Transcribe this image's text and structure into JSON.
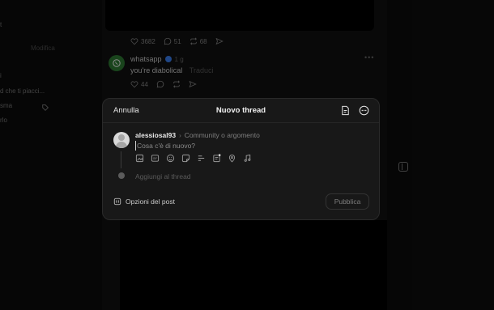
{
  "background": {
    "left_sidebar": {
      "items": [
        "t",
        "Modifica",
        "i",
        "d che ti piacci...",
        "sma",
        "rlo"
      ]
    },
    "top_post_actions": {
      "likes": "3682",
      "comments": "51",
      "reposts": "68"
    },
    "post": {
      "username": "whatsapp",
      "time": "1 g",
      "text": "you're diabolical",
      "translate": "Traduci",
      "likes": "44"
    }
  },
  "modal": {
    "cancel_label": "Annulla",
    "title": "Nuovo thread",
    "author": {
      "username": "alessiosal93",
      "topic_placeholder": "Community o argomento"
    },
    "compose": {
      "placeholder": "Cosa c'è di nuovo?"
    },
    "toolbar_icons": [
      "image-icon",
      "gif-icon",
      "emoji-icon",
      "sticker-icon",
      "poll-icon",
      "document-icon",
      "location-icon",
      "music-icon"
    ],
    "add_thread_label": "Aggiungi al thread",
    "post_options_label": "Opzioni del post",
    "publish_label": "Pubblica"
  }
}
